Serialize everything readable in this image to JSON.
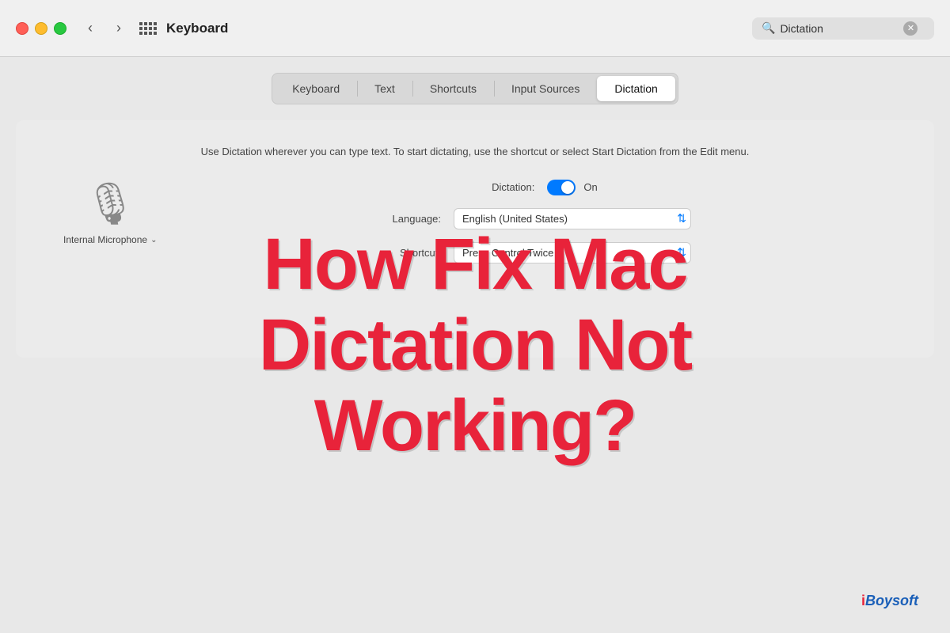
{
  "titlebar": {
    "title": "Keyboard",
    "search_placeholder": "Dictation",
    "search_value": "Dictation"
  },
  "tabs": {
    "items": [
      {
        "id": "keyboard",
        "label": "Keyboard",
        "active": false
      },
      {
        "id": "text",
        "label": "Text",
        "active": false
      },
      {
        "id": "shortcuts",
        "label": "Shortcuts",
        "active": false
      },
      {
        "id": "input-sources",
        "label": "Input Sources",
        "active": false
      },
      {
        "id": "dictation",
        "label": "Dictation",
        "active": true
      }
    ]
  },
  "settings": {
    "description": "Use Dictation wherever you can type text. To start dictating, use the shortcut or select Start Dictation from the Edit menu.",
    "dictation_label": "Dictation:",
    "dictation_status": "On",
    "language_label": "Language:",
    "language_value": "English (United States)",
    "shortcut_label": "Shortcut:",
    "shortcut_value": "Press Control Twice"
  },
  "mic": {
    "label": "Internal Microphone",
    "icon": "🎙"
  },
  "overlay": {
    "line1": "How Fix Mac",
    "line2": "Dictation Not",
    "line3": "Working?"
  },
  "branding": {
    "prefix": "i",
    "suffix": "Boysoft"
  },
  "icons": {
    "back_arrow": "‹",
    "forward_arrow": "›",
    "search": "🔍",
    "clear": "✕",
    "chevron": "⌄",
    "select_arrows": "⬍"
  }
}
